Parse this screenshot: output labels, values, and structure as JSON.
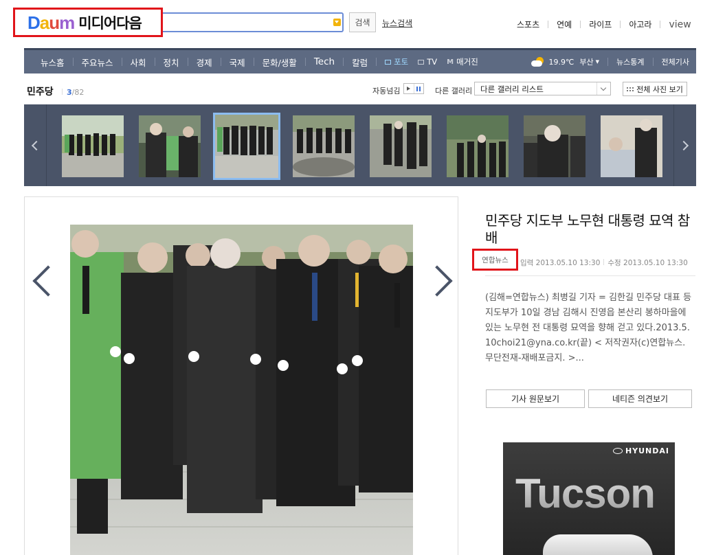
{
  "header": {
    "logo_letters": [
      "D",
      "a",
      "u",
      "m"
    ],
    "logo_media": "미디어다음",
    "search_placeholder": "",
    "search_button": "검색",
    "news_search": "뉴스검색",
    "top_nav": [
      "스포츠",
      "연예",
      "라이프",
      "아고라",
      "view"
    ]
  },
  "gnb": {
    "items": [
      "뉴스홈",
      "주요뉴스",
      "사회",
      "정치",
      "경제",
      "국제",
      "문화/생활",
      "Tech",
      "칼럼"
    ],
    "photo": "포토",
    "tv": "TV",
    "magazine": "매거진",
    "magazine_mark": "M",
    "weather_temp": "19.9℃",
    "weather_city": "부산",
    "stats": "뉴스통계",
    "all_articles": "전체기사"
  },
  "subbar": {
    "title": "민주당",
    "current": "3",
    "total": "/82",
    "auto_label": "자동넘김",
    "gallery_label": "다른 갤러리",
    "gallery_select": "다른 갤러리 리스트",
    "all_photos": "전체 사진 보기"
  },
  "thumbnails": {
    "count": 8,
    "selected_index": 2
  },
  "article": {
    "title": "민주당 지도부 노무현 대통령 묘역 참배",
    "source": "연합뉴스",
    "input_time": "입력 2013.05.10 13:30",
    "edit_time": "수정 2013.05.10 13:30",
    "body": "(김해=연합뉴스) 최병길 기자 = 김한길 민주당 대표 등 지도부가 10일 경남 김해시 진영읍 본산리 봉하마을에 있는 노무현 전 대통령 묘역을 향해 걷고 있다.2013.5.10choi21@yna.co.kr(끝) < 저작권자(c)연합뉴스. 무단전재-재배포금지. >...",
    "btn_original": "기사 원문보기",
    "btn_comments": "네티즌 의견보기"
  },
  "ad": {
    "brand": "HYUNDAI",
    "model": "Tucson"
  },
  "colors": {
    "highlight_red": "#e1141a",
    "gnb_bg": "#5d6a82",
    "strip_bg": "#4a5468",
    "selected_thumb": "#8bbcf0",
    "accent_blue": "#3a6fd4"
  }
}
